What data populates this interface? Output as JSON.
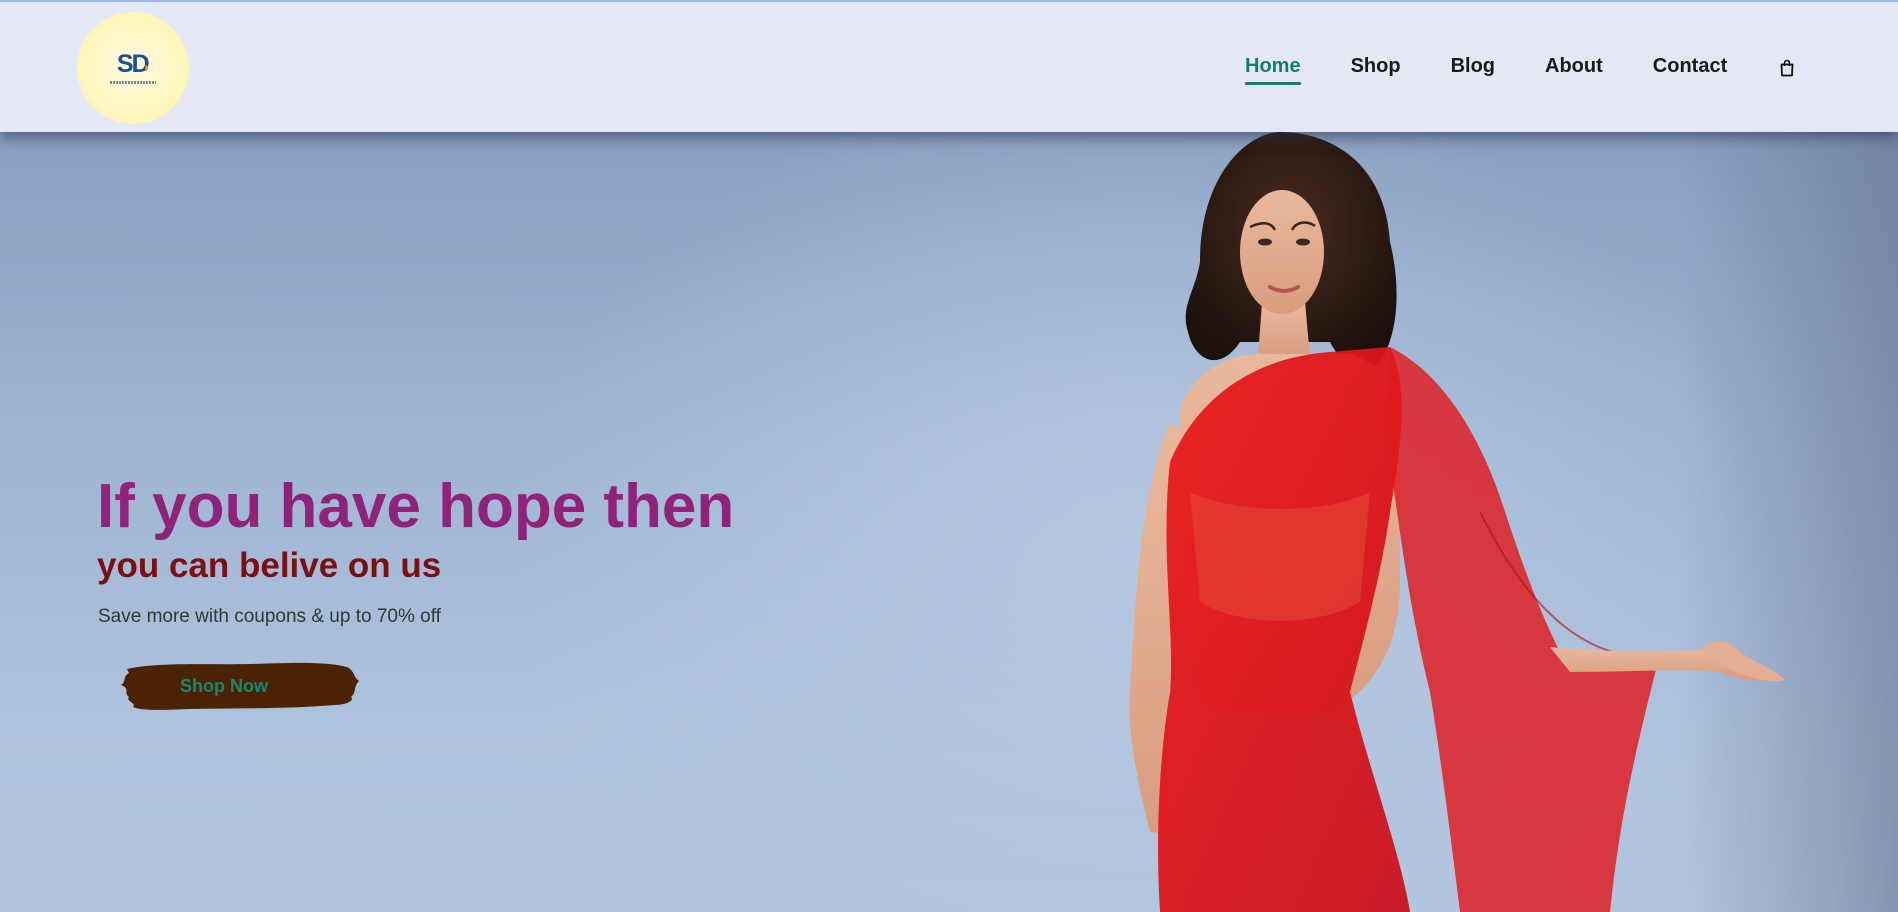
{
  "brand": {
    "logo_icon": "sd-logo",
    "logo_mark_s": "S",
    "logo_mark_d": "D",
    "colors": {
      "primary": "#1f4f95",
      "accent": "#f39c1a",
      "badge": "#fff7c2"
    }
  },
  "nav": {
    "items": [
      {
        "label": "Home",
        "active": true
      },
      {
        "label": "Shop",
        "active": false
      },
      {
        "label": "Blog",
        "active": false
      },
      {
        "label": "About",
        "active": false
      },
      {
        "label": "Contact",
        "active": false
      }
    ],
    "cart_icon": "shopping-bag-icon",
    "active_color": "#0f7f6f"
  },
  "hero": {
    "headline": "If you have hope then",
    "subheadline": "you can belive on us",
    "tagline": "Save more with coupons & up to 70% off",
    "cta_label": "Shop Now",
    "image": "model-in-red-saree-photo",
    "colors": {
      "headline": "#8e2379",
      "subheadline": "#7a0f14",
      "cta_text": "#148a72",
      "cta_background": "#4a2304"
    }
  }
}
